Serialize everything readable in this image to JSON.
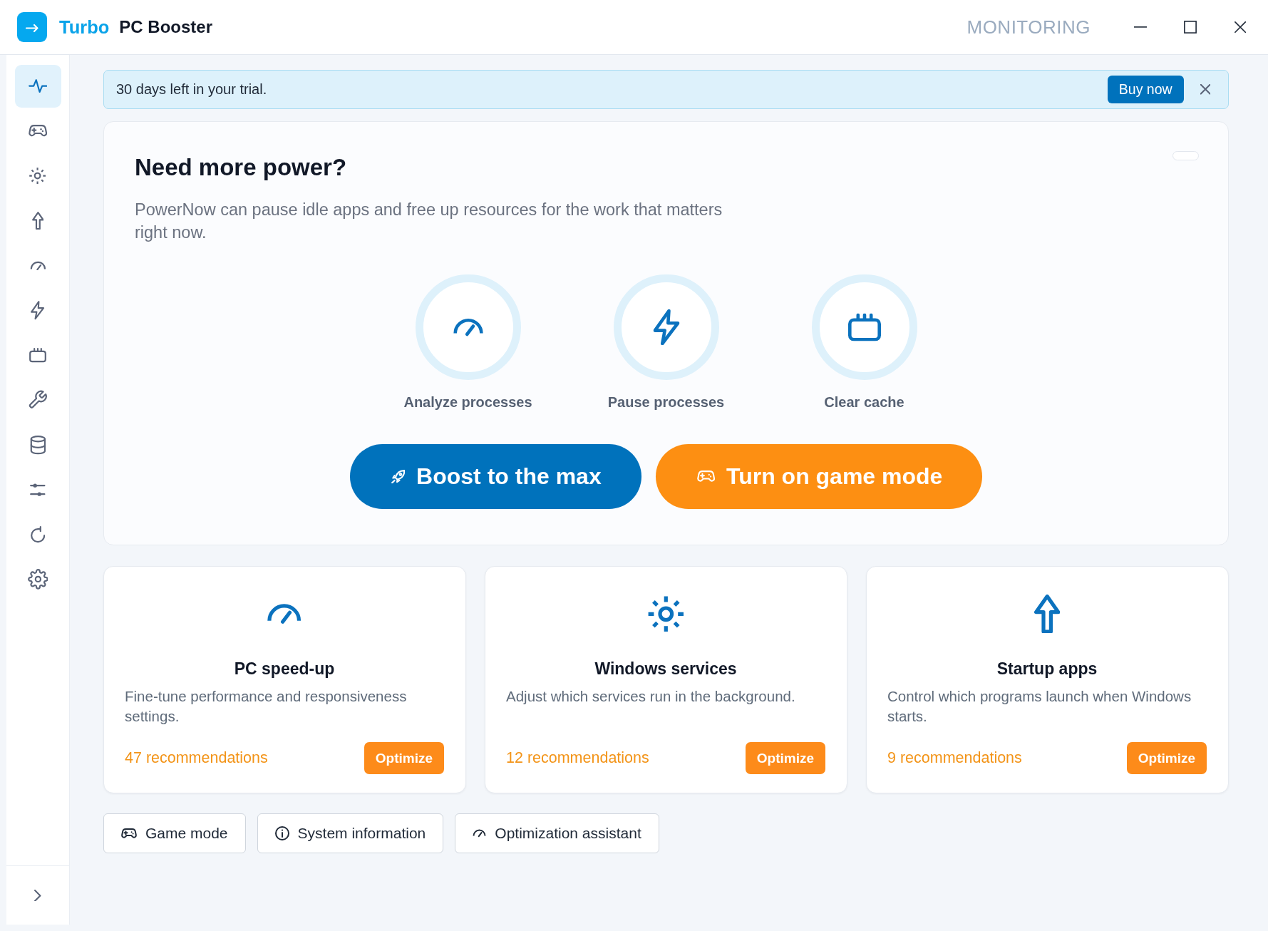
{
  "window": {
    "brand": "Turbo",
    "title": "PC Booster",
    "section": "MONITORING"
  },
  "sidebar": {
    "items": [
      {
        "kind": "pulse",
        "selected": true
      },
      {
        "kind": "gamepad",
        "selected": false
      },
      {
        "kind": "sun",
        "selected": false
      },
      {
        "kind": "uparrow",
        "selected": false
      },
      {
        "kind": "gauge",
        "selected": false
      },
      {
        "kind": "bolt",
        "selected": false
      },
      {
        "kind": "chip",
        "selected": false
      },
      {
        "kind": "wrench",
        "selected": false
      },
      {
        "kind": "database",
        "selected": false
      },
      {
        "kind": "sliders",
        "selected": false
      },
      {
        "kind": "refresh",
        "selected": false
      },
      {
        "kind": "gear",
        "selected": false
      }
    ]
  },
  "trial_banner": {
    "message": "30 days left in your trial.",
    "button": "Buy now"
  },
  "hero": {
    "title": "Need more power?",
    "description": "PowerNow can pause idle apps and free up resources for the work that matters right now.",
    "actions": [
      {
        "kind": "gauge",
        "label": "Analyze processes"
      },
      {
        "kind": "bolt",
        "label": "Pause processes"
      },
      {
        "kind": "chip",
        "label": "Clear cache"
      }
    ],
    "buttons": [
      {
        "kind": "boost",
        "label": "Boost to the max"
      },
      {
        "kind": "game",
        "label": "Turn on game mode"
      }
    ]
  },
  "cards": [
    {
      "kind": "gauge",
      "title": "PC speed-up",
      "description": "Fine-tune performance and responsiveness settings.",
      "recommendations": "47 recommendations",
      "button": "Optimize"
    },
    {
      "kind": "sun",
      "title": "Windows services",
      "description": "Adjust which services run in the background.",
      "recommendations": "12 recommendations",
      "button": "Optimize"
    },
    {
      "kind": "uparrow",
      "title": "Startup apps",
      "description": "Control which programs launch when Windows starts.",
      "recommendations": "9 recommendations",
      "button": "Optimize"
    }
  ],
  "shortcuts": [
    {
      "kind": "gamepad",
      "label": "Game mode"
    },
    {
      "kind": "info",
      "label": "System information"
    },
    {
      "kind": "gauge",
      "label": "Optimization assistant"
    }
  ]
}
